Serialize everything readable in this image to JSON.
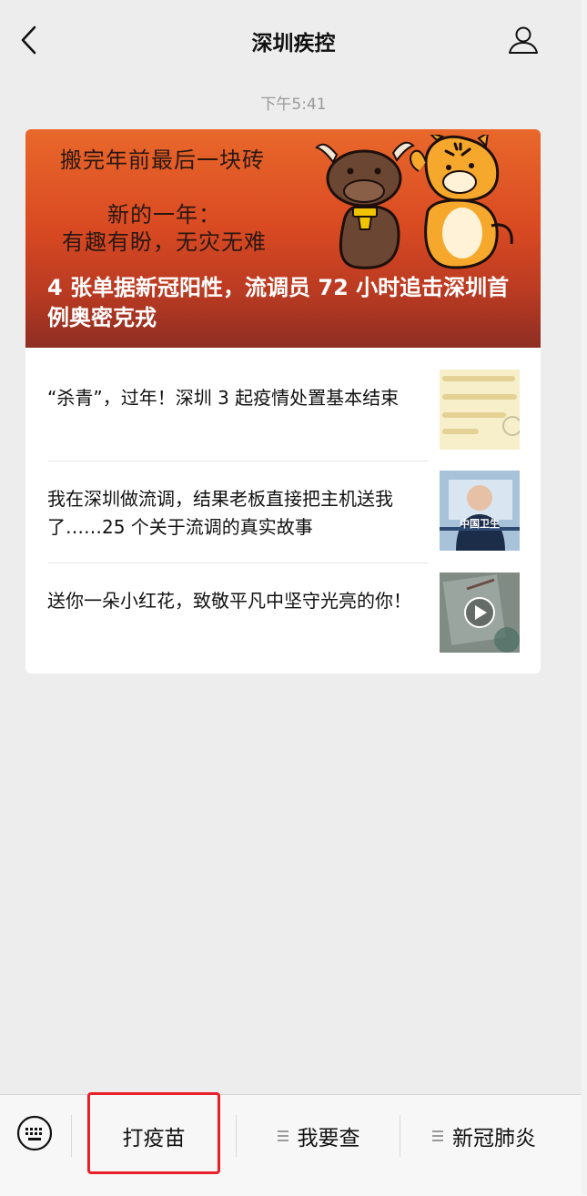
{
  "header": {
    "title": "深圳疾控"
  },
  "timestamp": "下午5:41",
  "article": {
    "cover_text_lines": [
      "搬完年前最后一块砖",
      "新的一年：",
      "有趣有盼，无灾无难"
    ],
    "main_title": "4 张单据新冠阳性，流调员 72 小时追击深圳首例奥密克戎",
    "items": [
      {
        "title": "“杀青”，过年！深圳 3 起疫情处置基本结束"
      },
      {
        "title": "我在深圳做流调，结果老板直接把主机送我了……25 个关于流调的真实故事",
        "thumb_text": "中国卫生"
      },
      {
        "title": "送你一朵小红花，致敬平凡中坚守光亮的你！"
      }
    ]
  },
  "bottom_menu": {
    "items": [
      "打疫苗",
      "我要查",
      "新冠肺炎"
    ]
  },
  "colors": {
    "highlight": "#e8202a",
    "background": "#ededed"
  }
}
